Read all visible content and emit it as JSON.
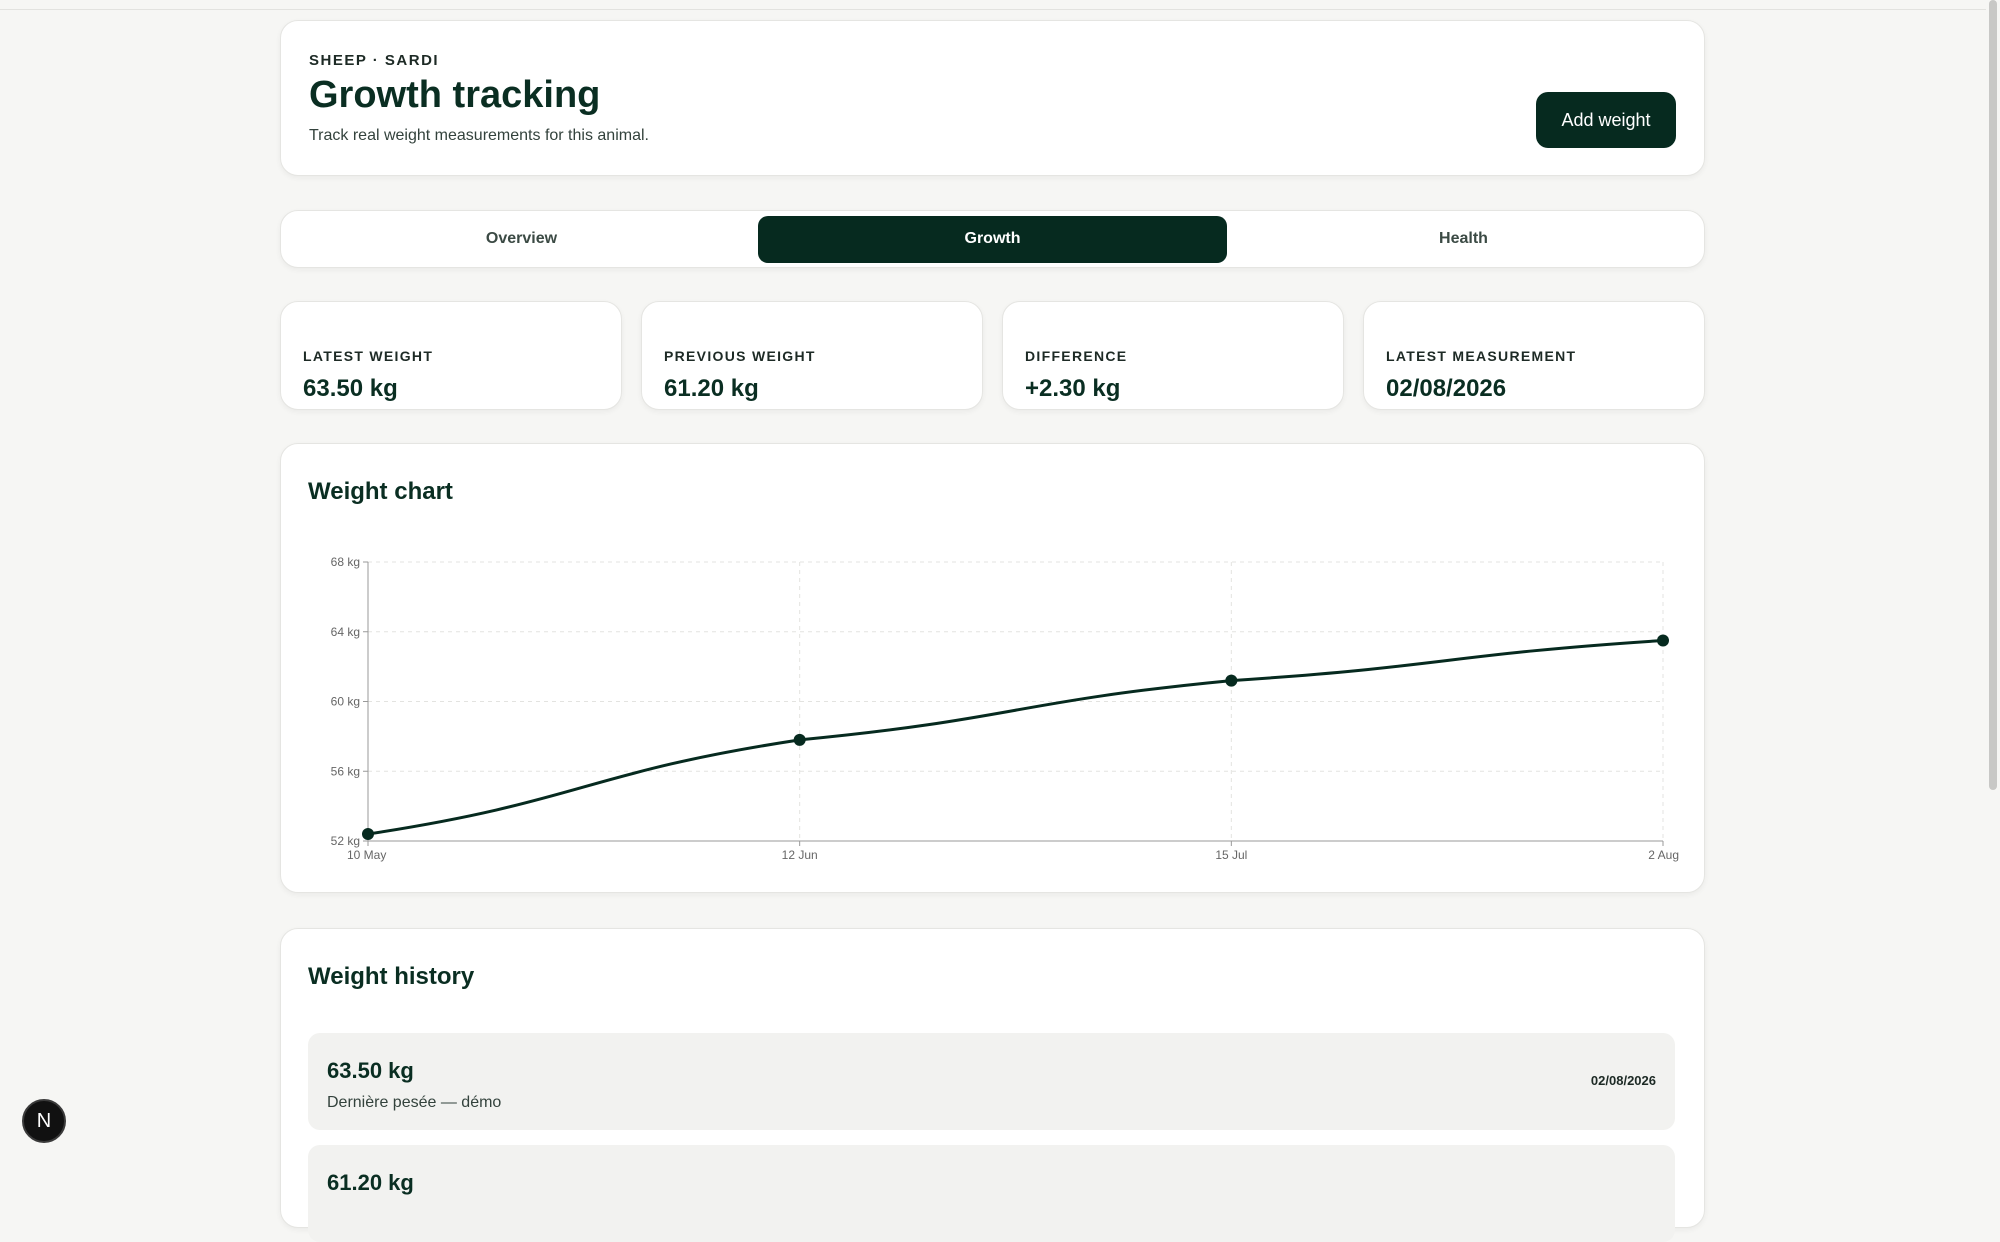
{
  "header": {
    "eyebrow": "SHEEP · SARDI",
    "title": "Growth tracking",
    "subtitle": "Track real weight measurements for this animal.",
    "add_button_label": "Add weight"
  },
  "tabs": [
    {
      "label": "Overview",
      "active": false
    },
    {
      "label": "Growth",
      "active": true
    },
    {
      "label": "Health",
      "active": false
    }
  ],
  "stats": [
    {
      "label": "LATEST WEIGHT",
      "value": "63.50 kg"
    },
    {
      "label": "PREVIOUS WEIGHT",
      "value": "61.20 kg"
    },
    {
      "label": "DIFFERENCE",
      "value": "+2.30 kg"
    },
    {
      "label": "LATEST MEASUREMENT",
      "value": "02/08/2026"
    }
  ],
  "chart": {
    "title": "Weight chart"
  },
  "chart_data": {
    "type": "line",
    "x": [
      "10 May",
      "12 Jun",
      "15 Jul",
      "2 Aug"
    ],
    "series": [
      {
        "values": [
          52.4,
          57.8,
          61.2,
          63.5
        ]
      }
    ],
    "yticks": [
      "52 kg",
      "56 kg",
      "60 kg",
      "64 kg",
      "68 kg"
    ],
    "ylim": [
      52,
      68
    ],
    "grid": true,
    "colors": {
      "line": "#062a1f",
      "grid": "#e3e3e0",
      "axis": "#999999"
    }
  },
  "history": {
    "title": "Weight history",
    "items": [
      {
        "weight": "63.50 kg",
        "note": "Dernière pesée — démo",
        "date": "02/08/2026"
      },
      {
        "weight": "61.20 kg"
      }
    ]
  },
  "badge": {
    "label": "N"
  },
  "colors": {
    "brand_dark": "#062a1f",
    "page_bg": "#f6f6f4"
  }
}
